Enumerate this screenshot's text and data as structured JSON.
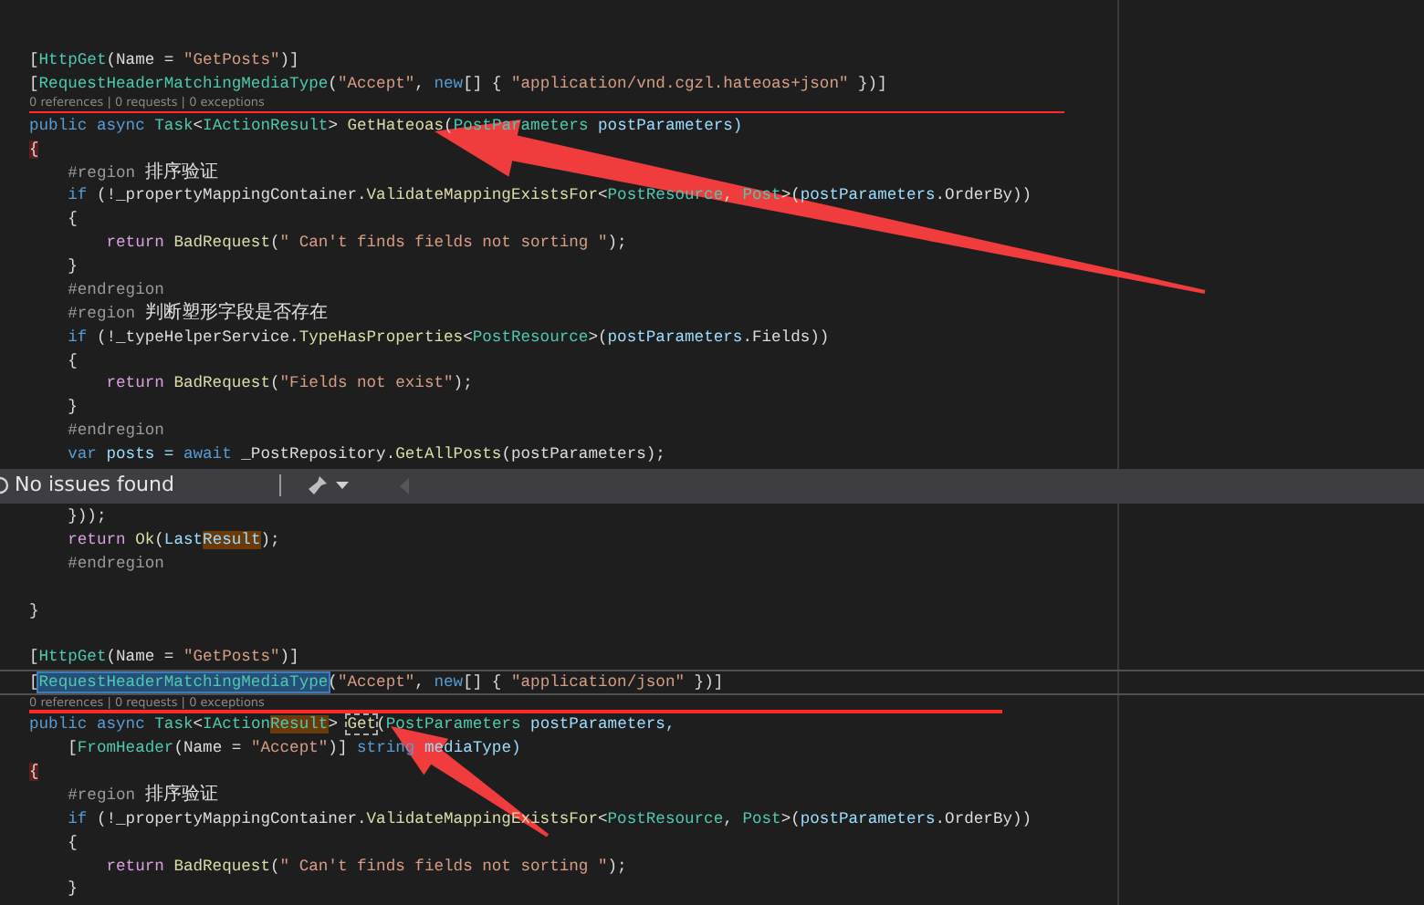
{
  "editor": {
    "lines_top": [
      {
        "kind": "blank"
      },
      {
        "kind": "blank"
      },
      {
        "kind": "code",
        "tokens": [
          {
            "text": "[",
            "kind": "plain"
          },
          {
            "text": "HttpGet",
            "kind": "type"
          },
          {
            "text": "(Name = ",
            "kind": "plain"
          },
          {
            "text": "\"GetPosts\"",
            "kind": "string"
          },
          {
            "text": ")]",
            "kind": "plain"
          }
        ]
      },
      {
        "kind": "code",
        "tokens": [
          {
            "text": "[",
            "kind": "plain"
          },
          {
            "text": "RequestHeaderMatchingMediaType",
            "kind": "type"
          },
          {
            "text": "(",
            "kind": "plain"
          },
          {
            "text": "\"Accept\"",
            "kind": "string"
          },
          {
            "text": ", ",
            "kind": "plain"
          },
          {
            "text": "new",
            "kind": "keyword"
          },
          {
            "text": "[] { ",
            "kind": "plain"
          },
          {
            "text": "\"application/vnd.cgzl.hateoas+json\"",
            "kind": "string"
          },
          {
            "text": " })]",
            "kind": "plain"
          }
        ]
      },
      {
        "kind": "codelens",
        "text": "0 references | 0 requests | 0 exceptions"
      },
      {
        "kind": "code",
        "tokens": [
          {
            "text": "public ",
            "kind": "keyword"
          },
          {
            "text": "async ",
            "kind": "keyword"
          },
          {
            "text": "Task",
            "kind": "type"
          },
          {
            "text": "<",
            "kind": "plain"
          },
          {
            "text": "IActionResult",
            "kind": "type"
          },
          {
            "text": "> ",
            "kind": "plain"
          },
          {
            "text": "GetHateoas",
            "kind": "method"
          },
          {
            "text": "(",
            "kind": "plain"
          },
          {
            "text": "PostParameters",
            "kind": "type"
          },
          {
            "text": " postParameters)",
            "kind": "param"
          }
        ]
      },
      {
        "kind": "code",
        "tokens": [
          {
            "text": "{",
            "kind": "brace"
          }
        ]
      },
      {
        "kind": "code",
        "tokens": [
          {
            "text": "    #region ",
            "kind": "preproc"
          },
          {
            "text": "排序验证",
            "kind": "cjk"
          }
        ]
      },
      {
        "kind": "code",
        "tokens": [
          {
            "text": "    if",
            "kind": "keyword"
          },
          {
            "text": " (!_propertyMappingContainer.",
            "kind": "plain"
          },
          {
            "text": "ValidateMappingExistsFor",
            "kind": "method"
          },
          {
            "text": "<",
            "kind": "plain"
          },
          {
            "text": "PostResource",
            "kind": "type"
          },
          {
            "text": ", ",
            "kind": "plain"
          },
          {
            "text": "Post",
            "kind": "type"
          },
          {
            "text": ">(",
            "kind": "plain"
          },
          {
            "text": "postParameters",
            "kind": "param"
          },
          {
            "text": ".OrderBy))",
            "kind": "plain"
          }
        ]
      },
      {
        "kind": "code",
        "tokens": [
          {
            "text": "    {",
            "kind": "plain"
          }
        ]
      },
      {
        "kind": "code",
        "tokens": [
          {
            "text": "        return ",
            "kind": "control"
          },
          {
            "text": "BadRequest",
            "kind": "method"
          },
          {
            "text": "(",
            "kind": "plain"
          },
          {
            "text": "\" Can't finds fields not sorting \"",
            "kind": "string"
          },
          {
            "text": ");",
            "kind": "plain"
          }
        ]
      },
      {
        "kind": "code",
        "tokens": [
          {
            "text": "    }",
            "kind": "plain"
          }
        ]
      },
      {
        "kind": "code",
        "tokens": [
          {
            "text": "    #endregion",
            "kind": "preproc"
          }
        ]
      },
      {
        "kind": "code",
        "tokens": [
          {
            "text": "    #region ",
            "kind": "preproc"
          },
          {
            "text": "判断塑形字段是否存在",
            "kind": "cjk"
          }
        ]
      },
      {
        "kind": "code",
        "tokens": [
          {
            "text": "    if",
            "kind": "keyword"
          },
          {
            "text": " (!_typeHelperService.",
            "kind": "plain"
          },
          {
            "text": "TypeHasProperties",
            "kind": "method"
          },
          {
            "text": "<",
            "kind": "plain"
          },
          {
            "text": "PostResource",
            "kind": "type"
          },
          {
            "text": ">(",
            "kind": "plain"
          },
          {
            "text": "postParameters",
            "kind": "param"
          },
          {
            "text": ".Fields))",
            "kind": "plain"
          }
        ]
      },
      {
        "kind": "code",
        "tokens": [
          {
            "text": "    {",
            "kind": "plain"
          }
        ]
      },
      {
        "kind": "code",
        "tokens": [
          {
            "text": "        return ",
            "kind": "control"
          },
          {
            "text": "BadRequest",
            "kind": "method"
          },
          {
            "text": "(",
            "kind": "plain"
          },
          {
            "text": "\"Fields not exist\"",
            "kind": "string"
          },
          {
            "text": ");",
            "kind": "plain"
          }
        ]
      },
      {
        "kind": "code",
        "tokens": [
          {
            "text": "    }",
            "kind": "plain"
          }
        ]
      },
      {
        "kind": "code",
        "tokens": [
          {
            "text": "    #endregion",
            "kind": "preproc"
          }
        ]
      },
      {
        "kind": "code",
        "tokens": [
          {
            "text": "    var",
            "kind": "keyword"
          },
          {
            "text": " posts = ",
            "kind": "param"
          },
          {
            "text": "await",
            "kind": "keyword"
          },
          {
            "text": " _PostRepository.",
            "kind": "plain"
          },
          {
            "text": "GetAllPosts",
            "kind": "method"
          },
          {
            "text": "(postParameters);",
            "kind": "plain"
          }
        ]
      }
    ],
    "lines_bottom": [
      {
        "kind": "code",
        "tokens": [
          {
            "text": "    }));",
            "kind": "plain"
          }
        ]
      },
      {
        "kind": "code",
        "tokens": [
          {
            "text": "    return ",
            "kind": "control"
          },
          {
            "text": "Ok",
            "kind": "method"
          },
          {
            "text": "(",
            "kind": "plain"
          },
          {
            "text": "Last",
            "kind": "param"
          },
          {
            "text": "Result",
            "kind": "paramref"
          },
          {
            "text": ");",
            "kind": "plain"
          }
        ]
      },
      {
        "kind": "code",
        "tokens": [
          {
            "text": "    #endregion",
            "kind": "preproc"
          }
        ]
      },
      {
        "kind": "blank"
      },
      {
        "kind": "code",
        "tokens": [
          {
            "text": "}",
            "kind": "plain"
          }
        ]
      },
      {
        "kind": "blank"
      },
      {
        "kind": "code",
        "tokens": [
          {
            "text": "[",
            "kind": "plain"
          },
          {
            "text": "HttpGet",
            "kind": "type"
          },
          {
            "text": "(Name = ",
            "kind": "plain"
          },
          {
            "text": "\"GetPosts\"",
            "kind": "string"
          },
          {
            "text": ")]",
            "kind": "plain"
          }
        ]
      },
      {
        "kind": "current",
        "tokens": [
          {
            "text": "[",
            "kind": "plain"
          },
          {
            "text": "RequestHeaderMatchingMediaType",
            "kind": "typeselected"
          },
          {
            "text": "(",
            "kind": "plain"
          },
          {
            "text": "\"Accept\"",
            "kind": "string"
          },
          {
            "text": ", ",
            "kind": "plain"
          },
          {
            "text": "new",
            "kind": "keyword"
          },
          {
            "text": "[] { ",
            "kind": "plain"
          },
          {
            "text": "\"application/json\"",
            "kind": "string"
          },
          {
            "text": " })]",
            "kind": "plain"
          }
        ]
      },
      {
        "kind": "codelens",
        "text": "0 references | 0 requests | 0 exceptions"
      },
      {
        "kind": "code",
        "tokens": [
          {
            "text": "public ",
            "kind": "keyword"
          },
          {
            "text": "async ",
            "kind": "keyword"
          },
          {
            "text": "Task",
            "kind": "type"
          },
          {
            "text": "<",
            "kind": "plain"
          },
          {
            "text": "IAction",
            "kind": "type"
          },
          {
            "text": "Result",
            "kind": "typeref"
          },
          {
            "text": "> ",
            "kind": "plain"
          },
          {
            "text": "Get",
            "kind": "methodfocus"
          },
          {
            "text": "(",
            "kind": "plain"
          },
          {
            "text": "PostParameters",
            "kind": "type"
          },
          {
            "text": " postParameters,",
            "kind": "param"
          }
        ]
      },
      {
        "kind": "code",
        "tokens": [
          {
            "text": "    [",
            "kind": "plain"
          },
          {
            "text": "FromHeader",
            "kind": "type"
          },
          {
            "text": "(Name = ",
            "kind": "plain"
          },
          {
            "text": "\"Accept\"",
            "kind": "string"
          },
          {
            "text": ")] ",
            "kind": "plain"
          },
          {
            "text": "string",
            "kind": "keyword"
          },
          {
            "text": " mediaType)",
            "kind": "param"
          }
        ]
      },
      {
        "kind": "code",
        "tokens": [
          {
            "text": "{",
            "kind": "brace"
          }
        ]
      },
      {
        "kind": "code",
        "tokens": [
          {
            "text": "    #region ",
            "kind": "preproc"
          },
          {
            "text": "排序验证",
            "kind": "cjk"
          }
        ]
      },
      {
        "kind": "code",
        "tokens": [
          {
            "text": "    if",
            "kind": "keyword"
          },
          {
            "text": " (!_propertyMappingContainer.",
            "kind": "plain"
          },
          {
            "text": "ValidateMappingExistsFor",
            "kind": "method"
          },
          {
            "text": "<",
            "kind": "plain"
          },
          {
            "text": "PostResource",
            "kind": "type"
          },
          {
            "text": ", ",
            "kind": "plain"
          },
          {
            "text": "Post",
            "kind": "type"
          },
          {
            "text": ">(",
            "kind": "plain"
          },
          {
            "text": "postParameters",
            "kind": "param"
          },
          {
            "text": ".OrderBy))",
            "kind": "plain"
          }
        ]
      },
      {
        "kind": "code",
        "tokens": [
          {
            "text": "    {",
            "kind": "plain"
          }
        ]
      },
      {
        "kind": "code",
        "tokens": [
          {
            "text": "        return ",
            "kind": "control"
          },
          {
            "text": "BadRequest",
            "kind": "method"
          },
          {
            "text": "(",
            "kind": "plain"
          },
          {
            "text": "\" Can't finds fields not sorting \"",
            "kind": "string"
          },
          {
            "text": ");",
            "kind": "plain"
          }
        ]
      },
      {
        "kind": "code",
        "tokens": [
          {
            "text": "    }",
            "kind": "plain"
          }
        ]
      }
    ]
  },
  "status_bar": {
    "message": "No issues found"
  }
}
